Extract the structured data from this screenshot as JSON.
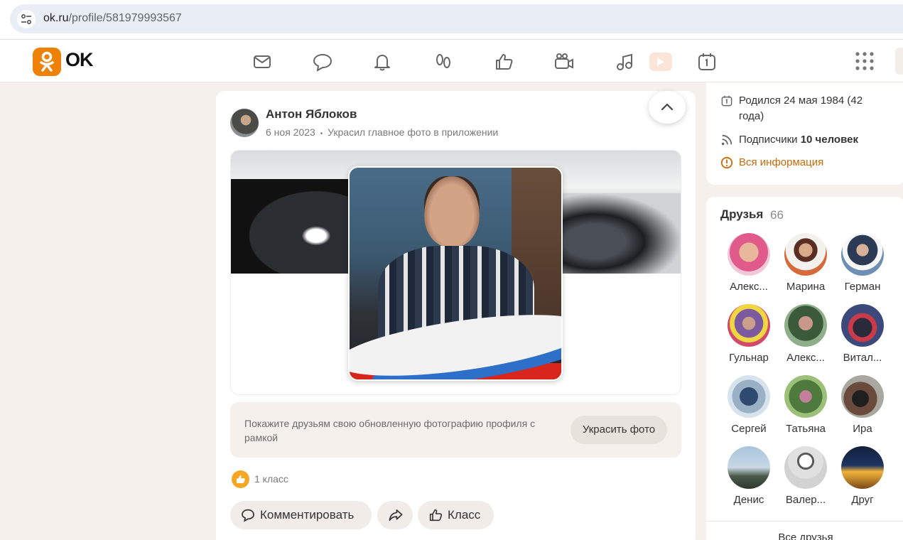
{
  "browser": {
    "url_domain": "ok.ru",
    "url_path": "/profile/581979993567"
  },
  "header": {
    "logo_text": "OK",
    "nav_icons": [
      "mail-icon",
      "chat-icon",
      "bell-icon",
      "guests-icon",
      "like-icon",
      "video-camera-icon",
      "music-icon",
      "video-play-icon",
      "calendar-icon",
      "apps-grid-icon"
    ]
  },
  "post": {
    "author": "Антон Яблоков",
    "date": "6 ноя 2023",
    "separator": "•",
    "action": "Украсил главное фото в приложении",
    "promo_text": "Покажите друзьям свою обновленную фотографию профиля с рамкой",
    "promo_button": "Украсить фото",
    "likes_text": "1 класс",
    "comment_label": "Комментировать",
    "like_label": "Класс"
  },
  "profile_info": {
    "birthday": "Родился 24 мая 1984 (42",
    "birthday_line2": "года)",
    "subscribers_prefix": "Подписчики ",
    "subscribers_count": "10 человек",
    "all_info": "Вся информация"
  },
  "friends": {
    "title": "Друзья",
    "count": "66",
    "list": [
      {
        "name": "Алекс..."
      },
      {
        "name": "Марина"
      },
      {
        "name": "Герман"
      },
      {
        "name": "Гульнар"
      },
      {
        "name": "Алекс..."
      },
      {
        "name": "Витал..."
      },
      {
        "name": "Сергей"
      },
      {
        "name": "Татьяна"
      },
      {
        "name": "Ира"
      },
      {
        "name": "Денис"
      },
      {
        "name": "Валер..."
      },
      {
        "name": "Друг"
      }
    ],
    "all_friends": "Все друзья"
  },
  "colors": {
    "brand_orange": "#ee8208",
    "link_orange": "#c96a08",
    "page_bg": "#f5f0eb"
  }
}
